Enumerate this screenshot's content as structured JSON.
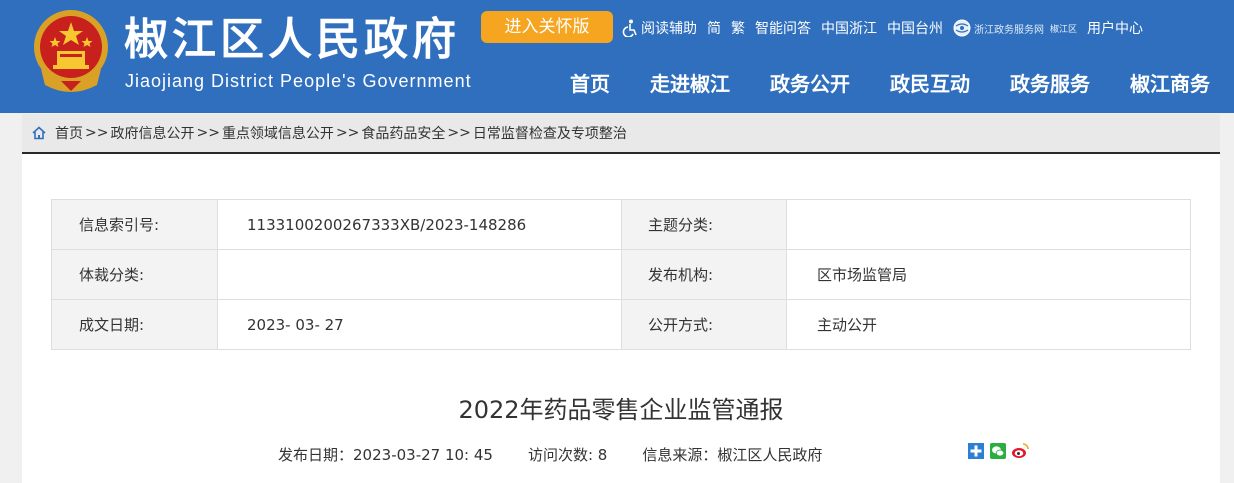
{
  "header": {
    "title": "椒江区人民政府",
    "subtitle": "Jiaojiang District People's Government",
    "care_button": "进入关怀版",
    "links": {
      "reading_aid": "阅读辅助",
      "simplified": "简",
      "traditional": "繁",
      "smart_qa": "智能问答",
      "china_zhejiang": "中国浙江",
      "china_taizhou": "中国台州",
      "service_site": "浙江政务服务网",
      "service_district": "椒江区",
      "user_center": "用户中心"
    },
    "nav": [
      "首页",
      "走进椒江",
      "政务公开",
      "政民互动",
      "政务服务",
      "椒江商务"
    ]
  },
  "breadcrumb": {
    "items": [
      "首页",
      "政府信息公开",
      "重点领域信息公开",
      "食品药品安全",
      "日常监督检查及专项整治"
    ],
    "separator": ">>"
  },
  "meta": {
    "index_no_label": "信息索引号:",
    "index_no": "1133100200267333XB/2023-148286",
    "topic_label": "主题分类:",
    "topic": "",
    "genre_label": "体裁分类:",
    "genre": "",
    "issuer_label": "发布机构:",
    "issuer": "区市场监管局",
    "date_label": "成文日期:",
    "date": "2023- 03- 27",
    "disclosure_label": "公开方式:",
    "disclosure": "主动公开"
  },
  "article": {
    "title": "2022年药品零售企业监管通报",
    "publish_label": "发布日期：",
    "publish_date": "2023-03-27 10: 45",
    "visits_label": "访问次数:",
    "visits": "8",
    "source_label": "信息来源：",
    "source": "椒江区人民政府"
  },
  "colors": {
    "header_bg": "#2f6fbd",
    "care_button_bg": "#f5a520",
    "breadcrumb_bg": "#e9e9e9"
  },
  "icons": {
    "emblem": "national-emblem-icon",
    "accessibility": "accessibility-icon",
    "home": "home-icon",
    "share": [
      "share-plus-icon",
      "wechat-icon",
      "weibo-icon"
    ]
  }
}
